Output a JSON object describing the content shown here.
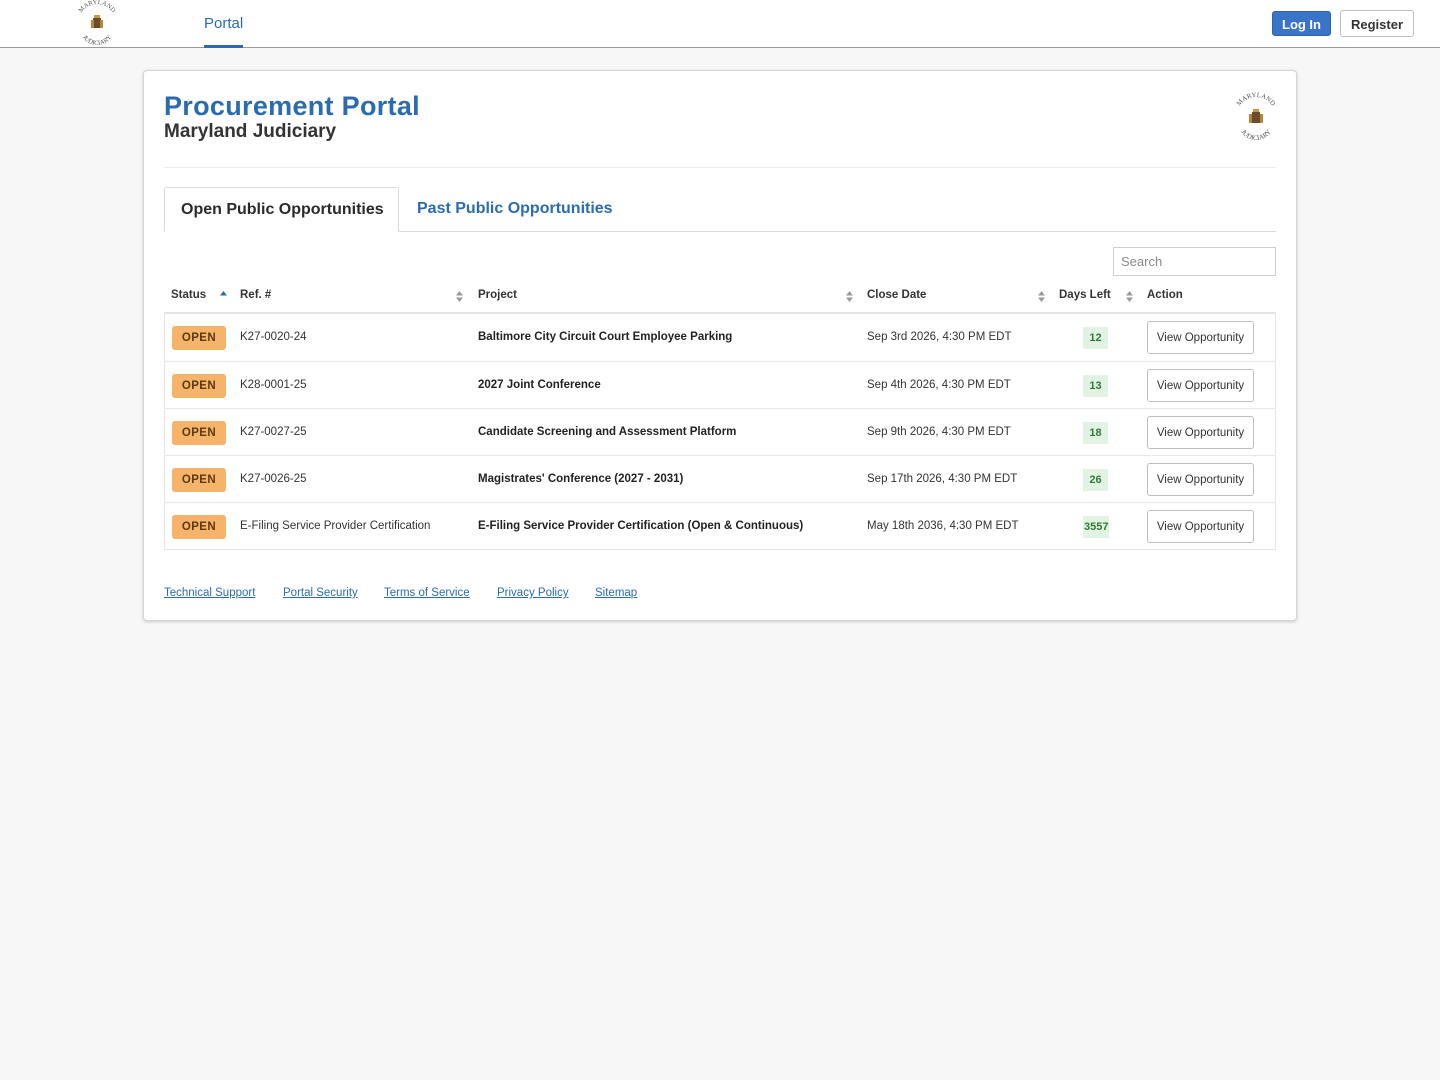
{
  "nav": {
    "seal_text_top": "MARYLAND",
    "seal_text_bottom": "JUDICIARY",
    "portal_label": "Portal",
    "login_label": "Log In",
    "register_label": "Register"
  },
  "header": {
    "title": "Procurement Portal",
    "subtitle": "Maryland Judiciary"
  },
  "tabs": [
    {
      "label": "Open Public Opportunities",
      "active": true
    },
    {
      "label": "Past Public Opportunities",
      "active": false
    }
  ],
  "search": {
    "placeholder": "Search",
    "value": ""
  },
  "table": {
    "columns": [
      "Status",
      "Ref. #",
      "Project",
      "Close Date",
      "Days Left",
      "Action"
    ],
    "sorted_column": "Status",
    "sort_direction": "ascending",
    "rows": [
      {
        "status": "OPEN",
        "ref": "K27-0020-24",
        "project": "Baltimore City Circuit Court Employee Parking",
        "close_date": "Sep 3rd 2026, 4:30 PM EDT",
        "days_left": "12",
        "action": "View Opportunity"
      },
      {
        "status": "OPEN",
        "ref": "K28-0001-25",
        "project": "2027 Joint Conference",
        "close_date": "Sep 4th 2026, 4:30 PM EDT",
        "days_left": "13",
        "action": "View Opportunity"
      },
      {
        "status": "OPEN",
        "ref": "K27-0027-25",
        "project": "Candidate Screening and Assessment Platform",
        "close_date": "Sep 9th 2026, 4:30 PM EDT",
        "days_left": "18",
        "action": "View Opportunity"
      },
      {
        "status": "OPEN",
        "ref": "K27-0026-25",
        "project": "Magistrates' Conference (2027 - 2031)",
        "close_date": "Sep 17th 2026, 4:30 PM EDT",
        "days_left": "26",
        "action": "View Opportunity"
      },
      {
        "status": "OPEN",
        "ref": "E-Filing Service Provider Certification",
        "project": "E-Filing Service Provider Certification (Open & Continuous)",
        "close_date": "May 18th 2036, 4:30 PM EDT",
        "days_left": "3557",
        "action": "View Opportunity"
      }
    ]
  },
  "footer": {
    "links": [
      "Technical Support",
      "Portal Security",
      "Terms of Service",
      "Privacy Policy",
      "Sitemap"
    ]
  },
  "colors": {
    "brand_blue": "#2b6cb0",
    "login_blue": "#3a74c9",
    "open_badge": "#f6b36a",
    "days_left_bg": "#e3f3e3",
    "days_left_text": "#2e7d32"
  }
}
